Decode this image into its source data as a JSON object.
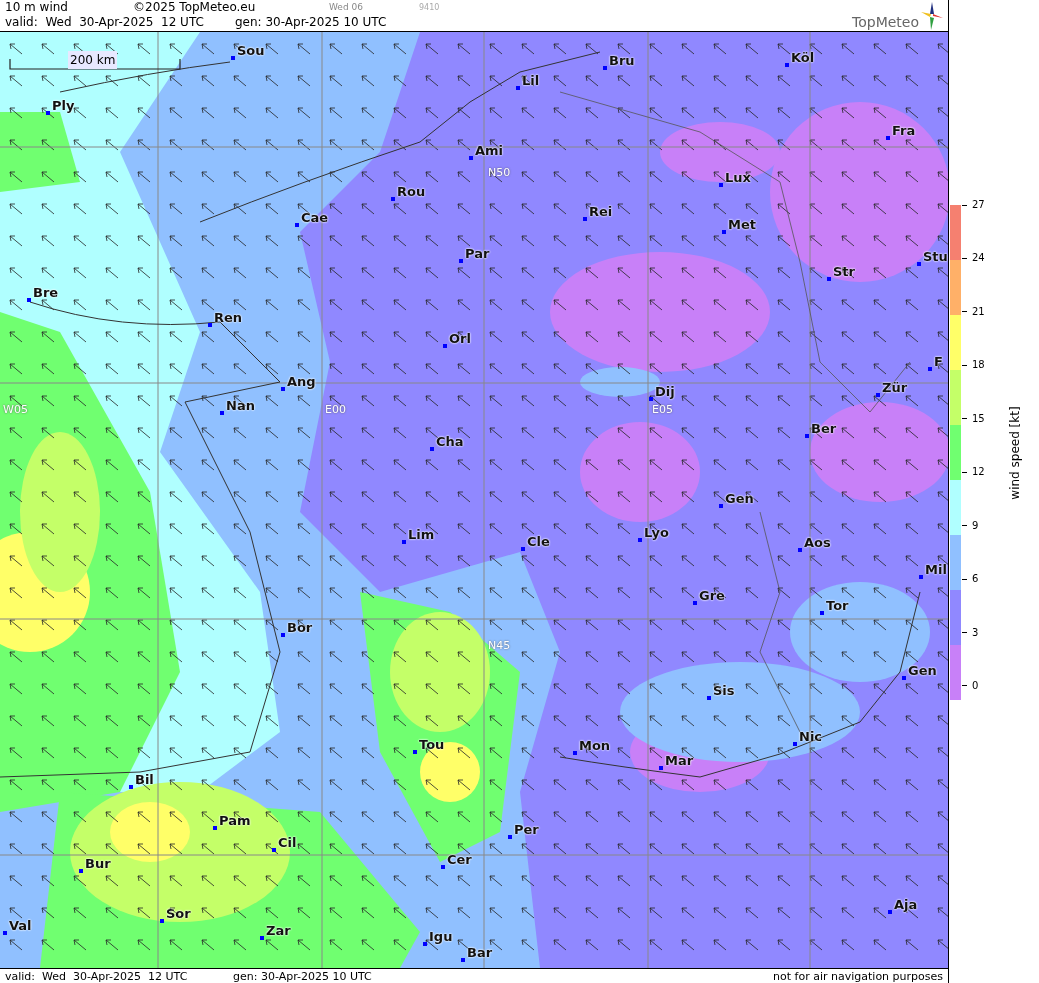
{
  "header": {
    "title": "10 m wind",
    "copyright": "©2025 TopMeteo.eu",
    "day": "Wed 06",
    "code": "9410",
    "valid": "valid:  Wed  30-Apr-2025  12 UTC",
    "gen": "gen: 30-Apr-2025 10 UTC",
    "logo": "TopMeteo"
  },
  "map": {
    "scale_bar": "200 km",
    "grid_labels": [
      {
        "text": "N50"
      },
      {
        "text": "W05"
      },
      {
        "text": "E00"
      },
      {
        "text": "E05"
      },
      {
        "text": "N45"
      }
    ],
    "cities": [
      {
        "name": "Sou"
      },
      {
        "name": "Bru"
      },
      {
        "name": "Köl"
      },
      {
        "name": "Lil"
      },
      {
        "name": "Ply"
      },
      {
        "name": "Ami"
      },
      {
        "name": "Fra"
      },
      {
        "name": "Lux"
      },
      {
        "name": "Rou"
      },
      {
        "name": "Cae"
      },
      {
        "name": "Rei"
      },
      {
        "name": "Met"
      },
      {
        "name": "Par"
      },
      {
        "name": "Stu"
      },
      {
        "name": "Str"
      },
      {
        "name": "Bre"
      },
      {
        "name": "Ren"
      },
      {
        "name": "Orl"
      },
      {
        "name": "F"
      },
      {
        "name": "Ang"
      },
      {
        "name": "Dij"
      },
      {
        "name": "Zür"
      },
      {
        "name": "Nan"
      },
      {
        "name": "Ber"
      },
      {
        "name": "Cha"
      },
      {
        "name": "Gen"
      },
      {
        "name": "Lim"
      },
      {
        "name": "Cle"
      },
      {
        "name": "Lyo"
      },
      {
        "name": "Aos"
      },
      {
        "name": "Mil"
      },
      {
        "name": "Gre"
      },
      {
        "name": "Tor"
      },
      {
        "name": "Bor"
      },
      {
        "name": "Gen"
      },
      {
        "name": "Sis"
      },
      {
        "name": "Nic"
      },
      {
        "name": "Tou"
      },
      {
        "name": "Mon"
      },
      {
        "name": "Mar"
      },
      {
        "name": "Bil"
      },
      {
        "name": "Pam"
      },
      {
        "name": "Per"
      },
      {
        "name": "Cil"
      },
      {
        "name": "Cer"
      },
      {
        "name": "Bur"
      },
      {
        "name": "Sor"
      },
      {
        "name": "Aja"
      },
      {
        "name": "Val"
      },
      {
        "name": "Zar"
      },
      {
        "name": "Igu"
      },
      {
        "name": "Bar"
      }
    ]
  },
  "legend": {
    "title": "wind speed [kt]",
    "ticks": [
      "27",
      "24",
      "21",
      "18",
      "15",
      "12",
      "9",
      "6",
      "3",
      "0"
    ],
    "bands": [
      {
        "color": "#f58070"
      },
      {
        "color": "#ffb068"
      },
      {
        "color": "#ffff68"
      },
      {
        "color": "#c4ff68"
      },
      {
        "color": "#70ff70"
      },
      {
        "color": "#b0ffff"
      },
      {
        "color": "#90c0ff"
      },
      {
        "color": "#9088ff"
      },
      {
        "color": "#c880f8"
      }
    ]
  },
  "footer": {
    "valid": "valid:  Wed  30-Apr-2025  12 UTC",
    "gen": "gen: 30-Apr-2025 10 UTC",
    "notice": "not for air navigation purposes"
  }
}
